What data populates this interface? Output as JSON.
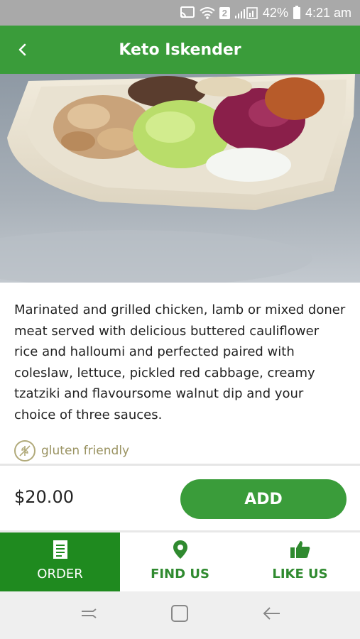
{
  "status_bar": {
    "battery_percent": "42%",
    "time": "4:21 am",
    "sim_badge": "2",
    "icons": [
      "cast-icon",
      "wifi-icon",
      "signal-icon",
      "battery-icon"
    ]
  },
  "header": {
    "title": "Keto Iskender",
    "back_icon": "chevron-left-icon"
  },
  "item": {
    "description": "Marinated and grilled chicken, lamb or mixed doner meat served with delicious buttered cauliflower rice and halloumi and perfected paired with coleslaw, lettuce, pickled red cabbage, creamy tzatziki and flavoursome walnut dip and your choice of three sauces.",
    "diet_label": "gluten friendly",
    "diet_icon": "no-gluten-icon",
    "price": "$20.00",
    "add_label": "ADD"
  },
  "tabs": [
    {
      "label": "ORDER",
      "icon": "menu-list-icon",
      "active": true
    },
    {
      "label": "FIND US",
      "icon": "location-pin-icon",
      "active": false
    },
    {
      "label": "LIKE US",
      "icon": "thumbs-up-icon",
      "active": false
    }
  ],
  "system_nav": [
    "recents-icon",
    "home-icon",
    "back-icon"
  ],
  "colors": {
    "brand_green": "#3a9c3a",
    "active_tab": "#1f8a1f",
    "status_bar": "#a9a9a9",
    "diet_text": "#9a9362"
  }
}
